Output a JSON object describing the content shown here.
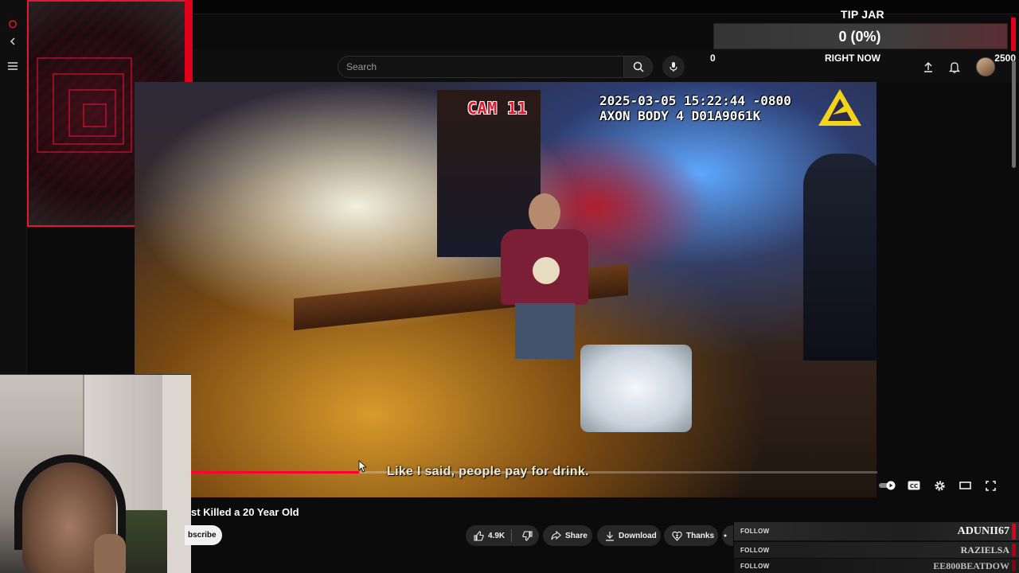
{
  "youtube": {
    "search_placeholder": "Search",
    "video_title": "st Killed a 20 Year Old",
    "subscribe_label": "bscribe",
    "like_count": "4.9K",
    "share_label": "Share",
    "download_label": "Download",
    "thanks_label": "Thanks",
    "progress_fraction": 0.245
  },
  "video_overlay": {
    "cam_label": "CAM 11",
    "timestamp": "2025-03-05 15:22:44 -0800",
    "device": "AXON BODY 4 D01A9061K",
    "subtitle": "Like I said, people pay for drink."
  },
  "tip_jar": {
    "title": "TIP JAR",
    "amount": "0 (0%)",
    "min": "0",
    "status": "RIGHT NOW",
    "goal": "2500",
    "fill_fraction": 0
  },
  "follows": [
    {
      "label": "FOLLOW",
      "name": "ADUNII67"
    },
    {
      "label": "FOLLOW",
      "name": "RAZIELSA"
    },
    {
      "label": "FOLLOW",
      "name": "EE800BEATDOW"
    }
  ],
  "colors": {
    "accent_red": "#e0001a",
    "youtube_red": "#ff0033",
    "subtitle_yellow": "#ece7c9"
  },
  "icons": {
    "browser": [
      "opera-icon",
      "back-icon",
      "menu-icon"
    ],
    "header": [
      "search-icon",
      "mic-icon",
      "upload-icon",
      "bell-icon"
    ],
    "player": [
      "autoplay-toggle",
      "cc-icon",
      "settings-icon",
      "theater-icon",
      "fullscreen-icon"
    ]
  }
}
